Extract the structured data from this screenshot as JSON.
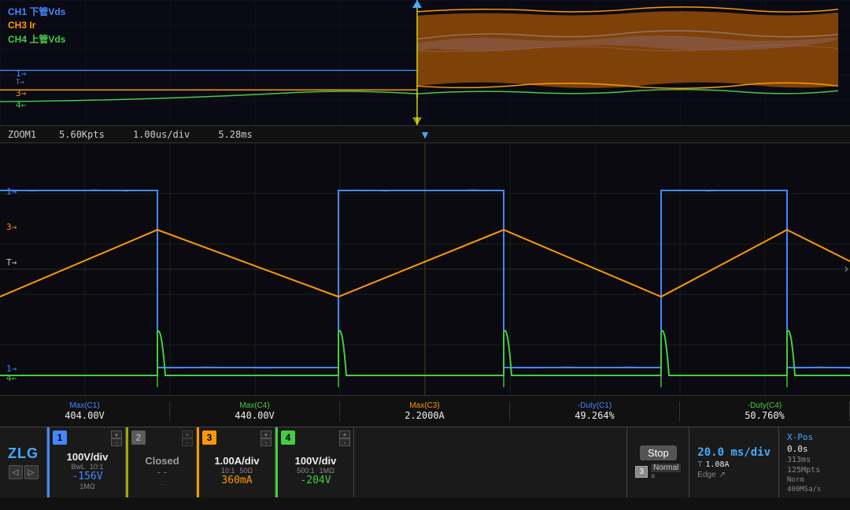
{
  "logo": "ZLG",
  "overview": {
    "ch1_label": "CH1 下管Vds",
    "ch3_label": "CH3 Ir",
    "ch4_label": "CH4 上管Vds",
    "ch1_color": "#4488ff",
    "ch3_color": "#ff9900",
    "ch4_color": "#44cc44"
  },
  "zoom": {
    "zoom_id": "ZOOM1",
    "kpts": "5.60Kpts",
    "time_div": "1.00us/div",
    "time_offset": "5.28ms"
  },
  "measurements": [
    {
      "label": "Max(C1)",
      "value": "404.00V",
      "color": "blue"
    },
    {
      "label": "Max(C4)",
      "value": "440.00V",
      "color": "green"
    },
    {
      "label": "Max(C3)",
      "value": "2.2000A",
      "color": "orange"
    },
    {
      "label": "-Duty(C1)",
      "value": "49.264%",
      "color": "blue"
    },
    {
      "label": "-Duty(C4)",
      "value": "50.760%",
      "color": "green"
    }
  ],
  "channels": [
    {
      "num": "1",
      "color": "#4488ff",
      "divV": "100V/div",
      "offset": "-156V",
      "sub1": "BwL",
      "sub2": "10:1",
      "sub3": "1MΩ"
    },
    {
      "num": "2",
      "color": "#ffff00",
      "divV": "Closed",
      "offset": "--",
      "sub1": "",
      "sub2": "..",
      "sub3": ""
    },
    {
      "num": "3",
      "color": "#ff9900",
      "divV": "1.00A/div",
      "offset": "360mA",
      "sub1": "10:1",
      "sub2": "50Ω",
      "sub3": ""
    },
    {
      "num": "4",
      "color": "#44cc44",
      "divV": "100V/div",
      "offset": "-204V",
      "sub1": "500:1",
      "sub2": "1MΩ",
      "sub3": ""
    }
  ],
  "trigger": {
    "stop_label": "Stop",
    "mode": "Normal",
    "ch_icon": "3",
    "time_div": "20.0 ms/div",
    "T_value": "1.08A",
    "sample_rate": "313ms",
    "sample_mpts": "125Mpts",
    "edge_label": "Edge",
    "norm_label": "Norm",
    "adc_rate": "400MSa/s",
    "xpos_label": "X-Pos",
    "xpos_val": "0.0s"
  }
}
